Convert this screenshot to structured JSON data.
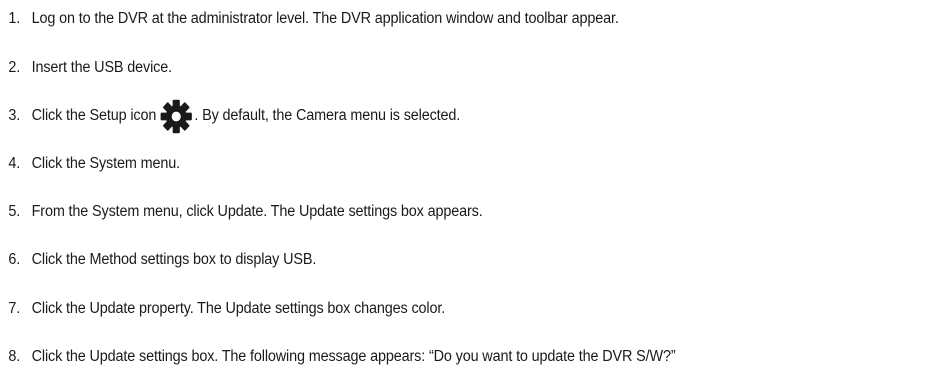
{
  "steps": [
    {
      "num": "1.",
      "text": "Log on to the DVR at the administrator level. The DVR application window and toolbar appear."
    },
    {
      "num": "2.",
      "text": "Insert the USB device."
    },
    {
      "num": "3.",
      "text_before": "Click the Setup icon",
      "icon": "gear-icon",
      "text_after": ". By default, the Camera menu is selected."
    },
    {
      "num": "4.",
      "text": "Click the System menu."
    },
    {
      "num": "5.",
      "text": "From the System menu, click Update. The Update settings box appears."
    },
    {
      "num": "6.",
      "text": "Click the Method settings box to display USB."
    },
    {
      "num": "7.",
      "text": "Click the Update property. The Update settings box changes color."
    },
    {
      "num": "8.",
      "text": "Click the Update settings box. The following message appears: “Do you want to update the DVR S/W?”"
    }
  ]
}
